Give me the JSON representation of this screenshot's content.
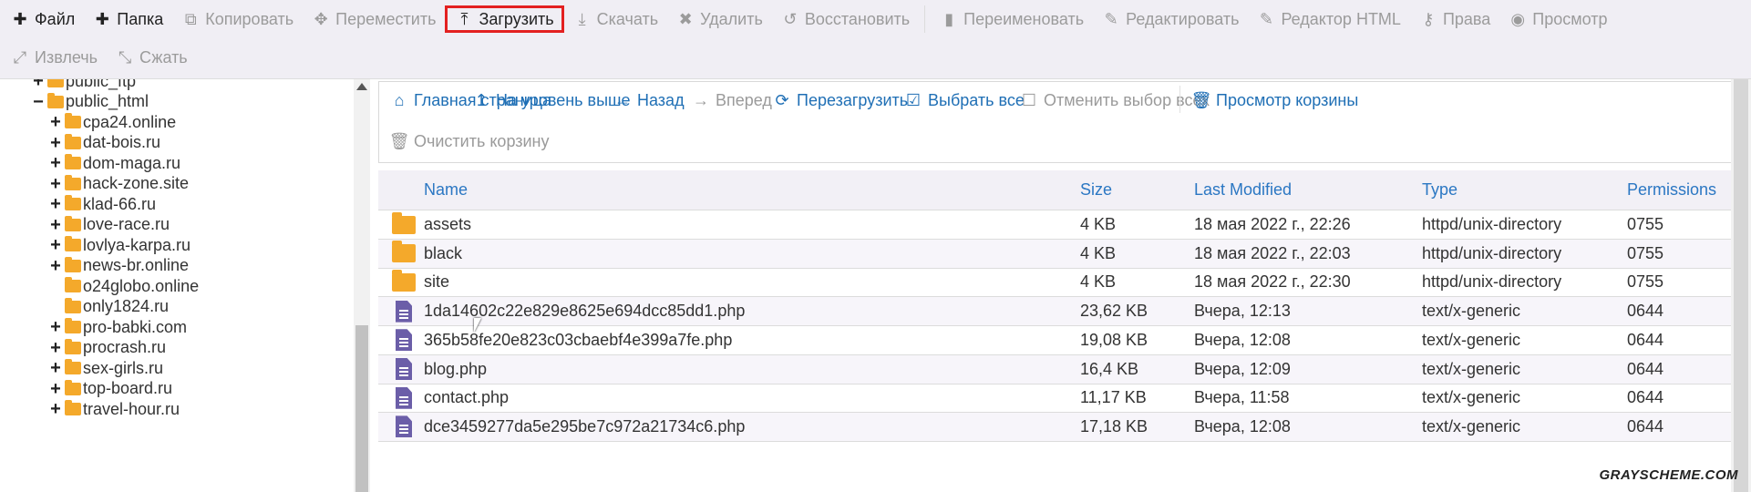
{
  "toolbar": {
    "row1": [
      {
        "icon": "plus-icon",
        "glyph": "✚",
        "label": "Файл",
        "state": "on"
      },
      {
        "icon": "plus-icon",
        "glyph": "✚",
        "label": "Папка",
        "state": "on"
      },
      {
        "icon": "copy-icon",
        "glyph": "⧉",
        "label": "Копировать",
        "state": "off"
      },
      {
        "icon": "move-icon",
        "glyph": "✥",
        "label": "Переместить",
        "state": "off"
      },
      {
        "icon": "upload-icon",
        "glyph": "⤒",
        "label": "Загрузить",
        "state": "highlight"
      },
      {
        "icon": "download-icon",
        "glyph": "⤓",
        "label": "Скачать",
        "state": "off"
      },
      {
        "icon": "delete-icon",
        "glyph": "✖",
        "label": "Удалить",
        "state": "off"
      },
      {
        "icon": "restore-icon",
        "glyph": "↺",
        "label": "Восстановить",
        "state": "off"
      },
      {
        "icon": "rename-icon",
        "glyph": "▮",
        "label": "Переименовать",
        "state": "off",
        "sep_before": true
      },
      {
        "icon": "edit-icon",
        "glyph": "✎",
        "label": "Редактировать",
        "state": "off"
      },
      {
        "icon": "html-editor-icon",
        "glyph": "✎",
        "label": "Редактор HTML",
        "state": "off"
      },
      {
        "icon": "key-icon",
        "glyph": "⚷",
        "label": "Права",
        "state": "off"
      },
      {
        "icon": "eye-icon",
        "glyph": "◉",
        "label": "Просмотр",
        "state": "off"
      }
    ],
    "row2": [
      {
        "icon": "extract-icon",
        "glyph": "⤢",
        "label": "Извлечь",
        "state": "off"
      },
      {
        "icon": "compress-icon",
        "glyph": "⤡",
        "label": "Сжать",
        "state": "off"
      }
    ]
  },
  "tree": [
    {
      "label": "public_ftp",
      "toggle": "+",
      "level": 1
    },
    {
      "label": "public_html",
      "toggle": "−",
      "level": 1
    },
    {
      "label": "cpa24.online",
      "toggle": "+",
      "level": 2
    },
    {
      "label": "dat-bois.ru",
      "toggle": "+",
      "level": 2
    },
    {
      "label": "dom-maga.ru",
      "toggle": "+",
      "level": 2
    },
    {
      "label": "hack-zone.site",
      "toggle": "+",
      "level": 2
    },
    {
      "label": "klad-66.ru",
      "toggle": "+",
      "level": 2
    },
    {
      "label": "love-race.ru",
      "toggle": "+",
      "level": 2
    },
    {
      "label": "lovlya-karpa.ru",
      "toggle": "+",
      "level": 2
    },
    {
      "label": "news-br.online",
      "toggle": "+",
      "level": 2
    },
    {
      "label": "o24globo.online",
      "toggle": "",
      "level": 2
    },
    {
      "label": "only1824.ru",
      "toggle": "",
      "level": 2
    },
    {
      "label": "pro-babki.com",
      "toggle": "+",
      "level": 2
    },
    {
      "label": "procrash.ru",
      "toggle": "+",
      "level": 2
    },
    {
      "label": "sex-girls.ru",
      "toggle": "+",
      "level": 2
    },
    {
      "label": "top-board.ru",
      "toggle": "+",
      "level": 2
    },
    {
      "label": "travel-hour.ru",
      "toggle": "+",
      "level": 2
    }
  ],
  "nav": {
    "row1": [
      {
        "icon": "home-icon",
        "glyph": "⌂",
        "label": "Главная страница",
        "state": "on"
      },
      {
        "icon": "level-up-icon",
        "glyph": "↥",
        "label": "На уровень выше",
        "state": "on"
      },
      {
        "icon": "arrow-left-icon",
        "glyph": "←",
        "label": "Назад",
        "state": "on"
      },
      {
        "icon": "arrow-right-icon",
        "glyph": "→",
        "label": "Вперед",
        "state": "off"
      },
      {
        "icon": "refresh-icon",
        "glyph": "⟳",
        "label": "Перезагрузить",
        "state": "on"
      },
      {
        "icon": "checkbox-checked-icon",
        "glyph": "☑",
        "label": "Выбрать все",
        "state": "on"
      },
      {
        "icon": "checkbox-empty-icon",
        "glyph": "☐",
        "label": "Отменить выбор всех",
        "state": "off"
      },
      {
        "icon": "trash-icon",
        "glyph": "🗑",
        "label": "Просмотр корзины",
        "state": "on"
      }
    ],
    "row2": [
      {
        "icon": "trash-icon",
        "glyph": "🗑",
        "label": "Очистить корзину",
        "state": "off"
      }
    ]
  },
  "table": {
    "headers": {
      "name": "Name",
      "size": "Size",
      "modified": "Last Modified",
      "type": "Type",
      "permissions": "Permissions"
    },
    "rows": [
      {
        "kind": "folder",
        "name": "assets",
        "size": "4 KB",
        "modified": "18 мая 2022 г., 22:26",
        "type": "httpd/unix-directory",
        "perm": "0755"
      },
      {
        "kind": "folder",
        "name": "black",
        "size": "4 KB",
        "modified": "18 мая 2022 г., 22:03",
        "type": "httpd/unix-directory",
        "perm": "0755"
      },
      {
        "kind": "folder",
        "name": "site",
        "size": "4 KB",
        "modified": "18 мая 2022 г., 22:30",
        "type": "httpd/unix-directory",
        "perm": "0755"
      },
      {
        "kind": "file",
        "name": "1da14602c22e829e8625e694dcc85dd1.php",
        "size": "23,62 KB",
        "modified": "Вчера, 12:13",
        "type": "text/x-generic",
        "perm": "0644"
      },
      {
        "kind": "file",
        "name": "365b58fe20e823c03cbaebf4e399a7fe.php",
        "size": "19,08 KB",
        "modified": "Вчера, 12:08",
        "type": "text/x-generic",
        "perm": "0644"
      },
      {
        "kind": "file",
        "name": "blog.php",
        "size": "16,4 KB",
        "modified": "Вчера, 12:09",
        "type": "text/x-generic",
        "perm": "0644"
      },
      {
        "kind": "file",
        "name": "contact.php",
        "size": "11,17 KB",
        "modified": "Вчера, 11:58",
        "type": "text/x-generic",
        "perm": "0644"
      },
      {
        "kind": "file",
        "name": "dce3459277da5e295be7c972a21734c6.php",
        "size": "17,18 KB",
        "modified": "Вчера, 12:08",
        "type": "text/x-generic",
        "perm": "0644"
      }
    ]
  },
  "watermark": "GRAYSCHEME.COM",
  "colors": {
    "link": "#1f6fb5",
    "folder": "#f4a92b",
    "file": "#6b5ea8",
    "highlight": "#e32020"
  }
}
